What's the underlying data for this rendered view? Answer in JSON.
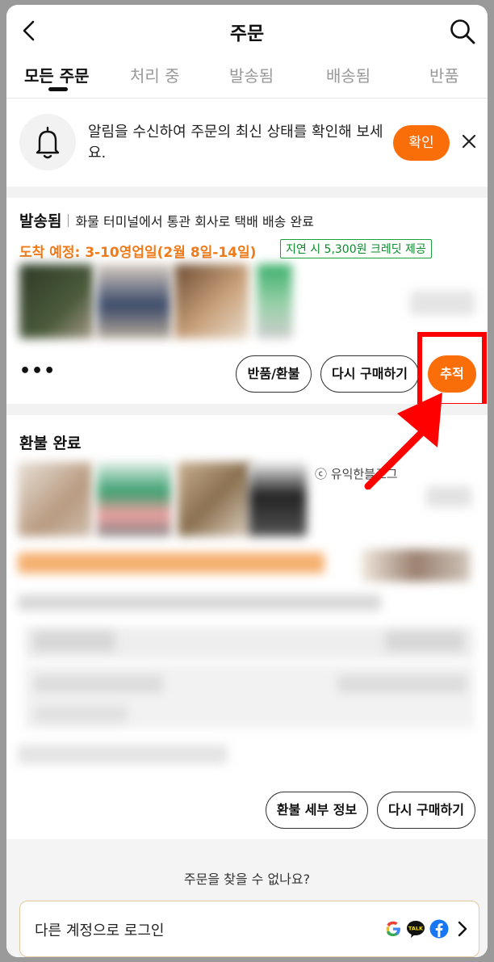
{
  "header": {
    "title": "주문"
  },
  "tabs": [
    {
      "label": "모든 주문",
      "active": true
    },
    {
      "label": "처리 중"
    },
    {
      "label": "발송됨"
    },
    {
      "label": "배송됨"
    },
    {
      "label": "반품"
    }
  ],
  "notice": {
    "text": "알림을 수신하여 주문의 최신 상태를 확인해 보세요.",
    "confirm_label": "확인"
  },
  "order1": {
    "status": "발송됨",
    "status_desc": "화물 터미널에서 통관 회사로 택배 배송 완료",
    "eta": "도착 예정: 3-10영업일(2월 8일-14일)",
    "credit_badge": "지연 시 5,300원 크레딧 제공",
    "more_label": "•••",
    "buttons": {
      "return": "반품/환불",
      "rebuy": "다시 구매하기",
      "track": "추적"
    }
  },
  "order2": {
    "status": "환불 완료",
    "watermark": "ⓒ 유익한블로그",
    "buttons": {
      "refund_details": "환불 세부 정보",
      "rebuy": "다시 구매하기"
    }
  },
  "footer": {
    "cant_find": "주문을 찾을 수 없나요?",
    "login_other": "다른 계정으로 로그인"
  },
  "colors": {
    "accent": "#fa6e0a",
    "eta": "#f07b1a",
    "credit_green": "#0a8a2a",
    "highlight": "#ff0000"
  }
}
